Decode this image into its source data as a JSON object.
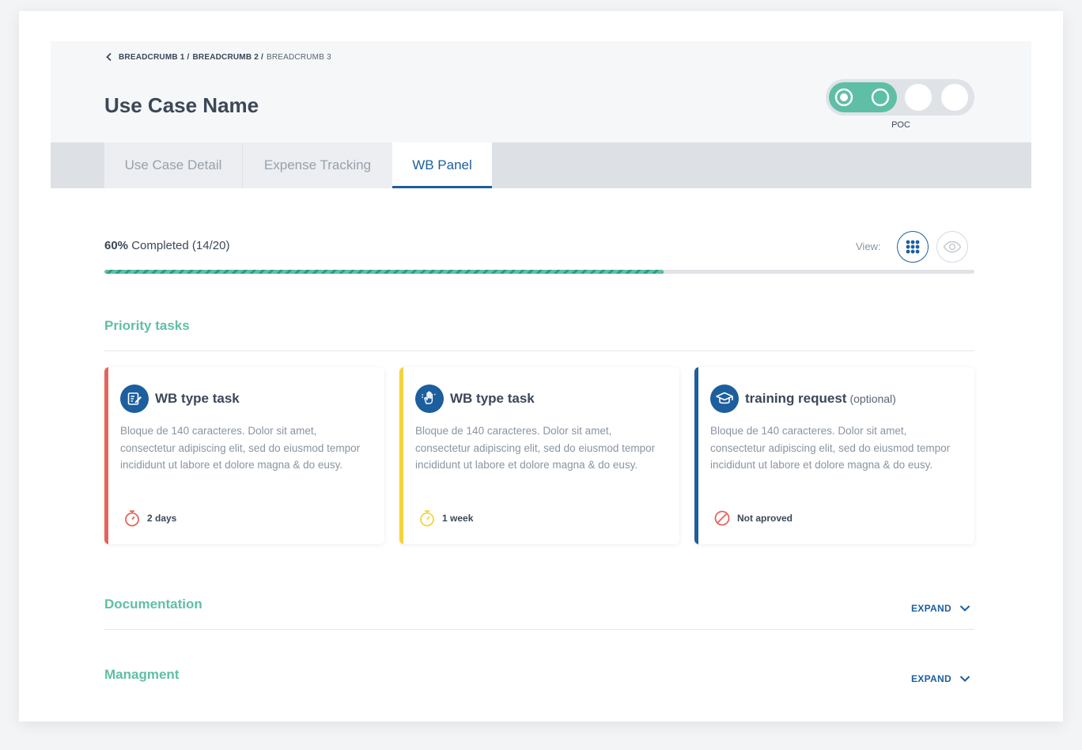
{
  "breadcrumb": {
    "items": [
      "BREADCRUMB 1 /",
      "BREADCRUMB 2 /",
      "BREADCRUMB 3"
    ]
  },
  "page": {
    "title": "Use Case Name"
  },
  "stage": {
    "label": "POC",
    "active_steps": 2,
    "total_steps": 4,
    "color": "#5fbfa6"
  },
  "tabs": [
    {
      "label": "Use Case Detail",
      "active": false
    },
    {
      "label": "Expense Tracking",
      "active": false
    },
    {
      "label": "WB Panel",
      "active": true
    }
  ],
  "progress": {
    "percent_label": "60%",
    "text": "Completed (14/20)",
    "fraction": 0.643,
    "color": "#5fbfa6"
  },
  "view": {
    "label": "View:",
    "options": [
      {
        "icon": "grid-icon",
        "active": true
      },
      {
        "icon": "eye-icon",
        "active": false
      }
    ]
  },
  "sections": {
    "priority": {
      "title": "Priority tasks"
    },
    "documentation": {
      "title": "Documentation",
      "expand_label": "EXPAND"
    },
    "management": {
      "title": "Managment",
      "expand_label": "EXPAND"
    }
  },
  "cards": [
    {
      "title": "WB type task",
      "optional": "",
      "icon": "edit-icon",
      "accent": "#e5645a",
      "description": "Bloque de 140 caracteres. Dolor sit amet, consectetur adipiscing elit, sed do eiusmod tempor incididunt ut labore et dolore magna & do eusy.",
      "meta_icon": "stopwatch-icon",
      "meta": "2 days"
    },
    {
      "title": "WB type task",
      "optional": "",
      "icon": "hand-icon",
      "accent": "#f5d33c",
      "description": "Bloque de 140 caracteres. Dolor sit amet, consectetur adipiscing elit, sed do eiusmod tempor incididunt ut labore et dolore magna & do eusy.",
      "meta_icon": "stopwatch-icon",
      "meta": "1 week"
    },
    {
      "title": "training request",
      "optional": "(optional)",
      "icon": "graduation-cap-icon",
      "accent": "#1c5e9e",
      "description": "Bloque de 140 caracteres. Dolor sit amet, consectetur adipiscing elit, sed do eiusmod tempor incididunt ut labore et dolore magna & do eusy.",
      "meta_icon": "forbidden-icon",
      "meta": "Not aproved"
    }
  ]
}
